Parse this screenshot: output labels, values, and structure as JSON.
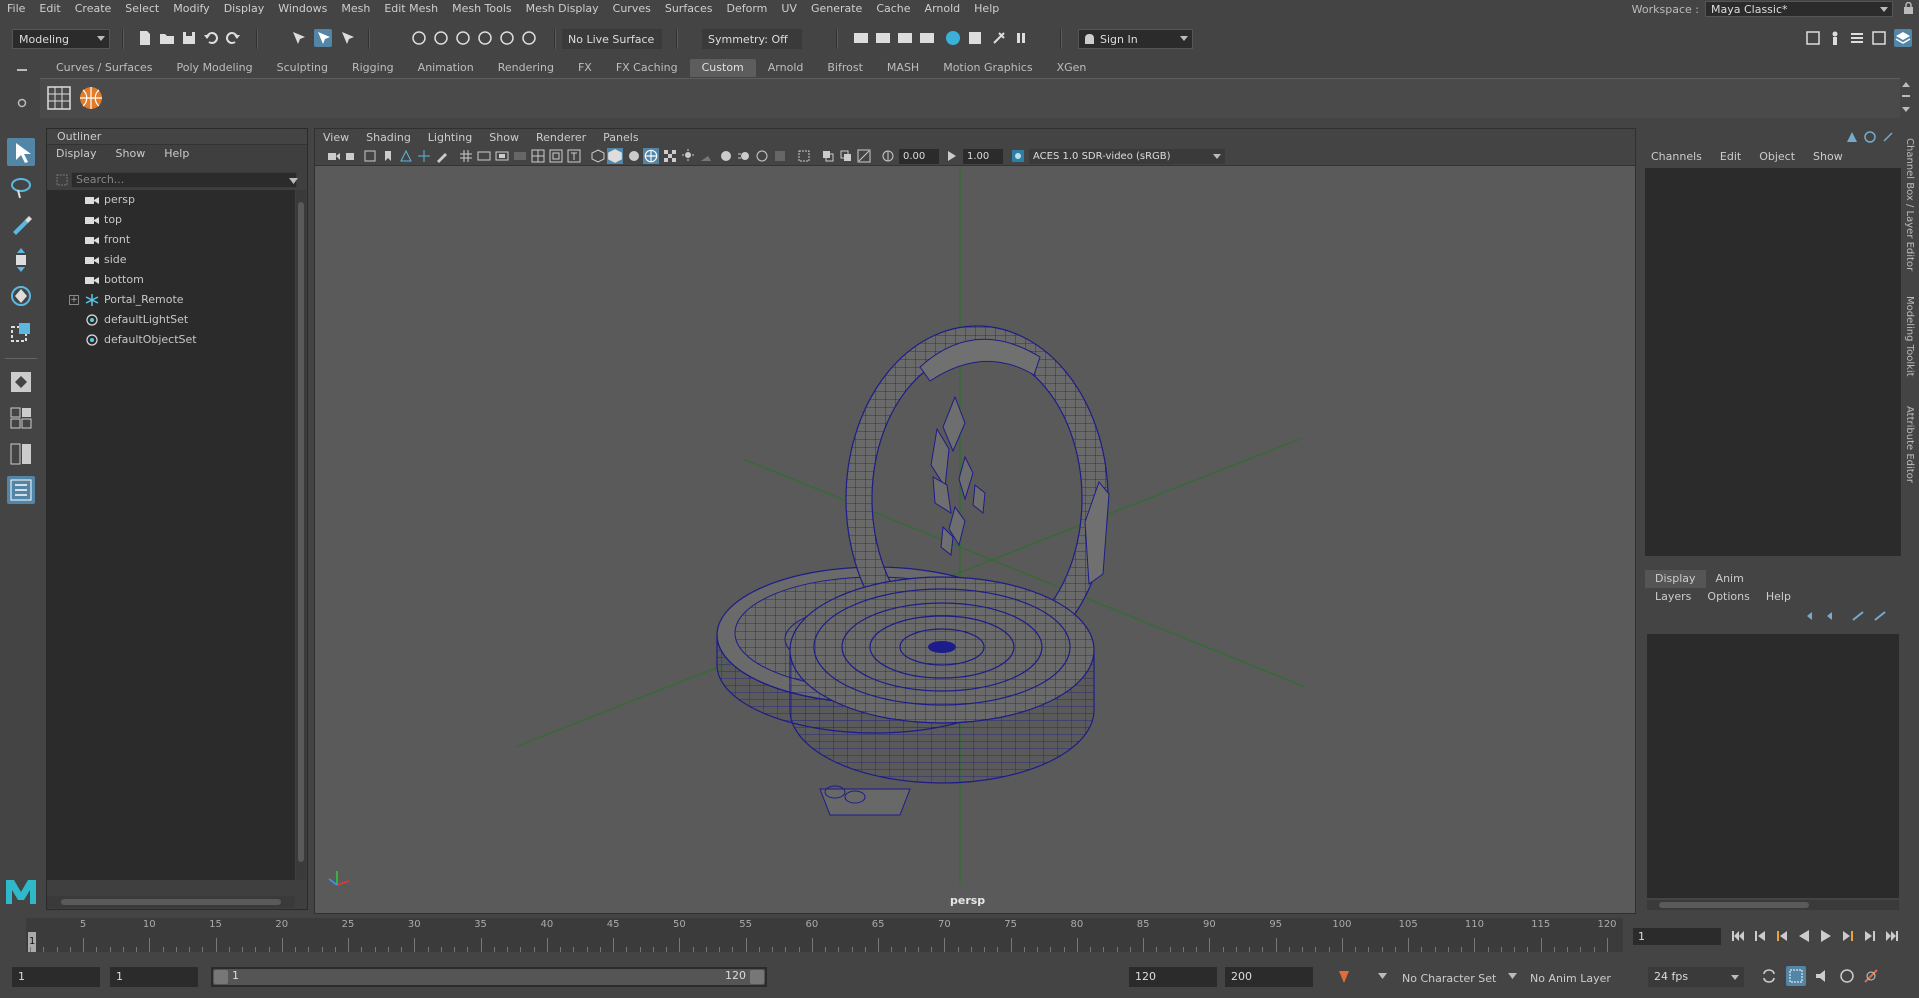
{
  "menubar": {
    "items": [
      "File",
      "Edit",
      "Create",
      "Select",
      "Modify",
      "Display",
      "Windows",
      "Mesh",
      "Edit Mesh",
      "Mesh Tools",
      "Mesh Display",
      "Curves",
      "Surfaces",
      "Deform",
      "UV",
      "Generate",
      "Cache",
      "Arnold",
      "Help"
    ],
    "workspace_label": "Workspace :",
    "workspace_value": "Maya Classic*"
  },
  "statusline": {
    "menuset": "Modeling",
    "live_surface": "No Live Surface",
    "symmetry": "Symmetry: Off",
    "sign_in": "Sign In"
  },
  "shelf": {
    "tabs": [
      "Curves / Surfaces",
      "Poly Modeling",
      "Sculpting",
      "Rigging",
      "Animation",
      "Rendering",
      "FX",
      "FX Caching",
      "Custom",
      "Arnold",
      "Bifrost",
      "MASH",
      "Motion Graphics",
      "XGen"
    ],
    "active_tab": "Custom"
  },
  "outliner": {
    "title": "Outliner",
    "menu": [
      "Display",
      "Show",
      "Help"
    ],
    "search_placeholder": "Search...",
    "items": [
      {
        "label": "persp",
        "icon": "camera-icon"
      },
      {
        "label": "top",
        "icon": "camera-icon"
      },
      {
        "label": "front",
        "icon": "camera-icon"
      },
      {
        "label": "side",
        "icon": "camera-icon"
      },
      {
        "label": "bottom",
        "icon": "camera-icon"
      },
      {
        "label": "Portal_Remote",
        "icon": "group-transform-icon",
        "expandable": true
      },
      {
        "label": "defaultLightSet",
        "icon": "set-icon"
      },
      {
        "label": "defaultObjectSet",
        "icon": "set-icon"
      }
    ]
  },
  "viewport": {
    "menu": [
      "View",
      "Shading",
      "Lighting",
      "Show",
      "Renderer",
      "Panels"
    ],
    "exposure": "0.00",
    "gamma": "1.00",
    "colorspace": "ACES 1.0 SDR-video (sRGB)",
    "camera_label": "persp"
  },
  "channelbox": {
    "menu": [
      "Channels",
      "Edit",
      "Object",
      "Show"
    ]
  },
  "layereditor": {
    "tabs": [
      "Display",
      "Anim"
    ],
    "active_tab": "Display",
    "menu": [
      "Layers",
      "Options",
      "Help"
    ]
  },
  "sidetabs": [
    "Channel Box / Layer Editor",
    "Modeling Toolkit",
    "Attribute Editor"
  ],
  "timeslider": {
    "labels": [
      "5",
      "10",
      "15",
      "20",
      "25",
      "30",
      "35",
      "40",
      "45",
      "50",
      "55",
      "60",
      "65",
      "70",
      "75",
      "80",
      "85",
      "90",
      "95",
      "100",
      "105",
      "110",
      "115",
      "120"
    ],
    "current_frame_marker": "1",
    "current_frame_field": "1"
  },
  "rangebar": {
    "start_time": "1",
    "playback_start": "1",
    "range_start_label": "1",
    "range_end_label": "120",
    "playback_end": "120",
    "end_time": "200",
    "character_set": "No Character Set",
    "anim_layer": "No Anim Layer",
    "fps": "24 fps"
  },
  "colors": {
    "accent": "#5285a6",
    "wire": "#1a1a8c",
    "grid_axis": "#2f6e2f"
  }
}
